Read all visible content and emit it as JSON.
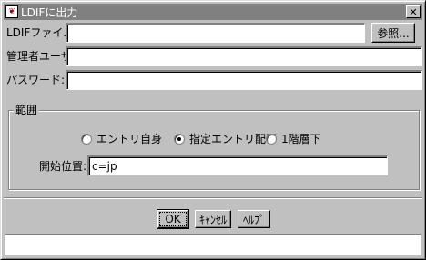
{
  "window": {
    "title": "LDIFに出力",
    "close_icon": "close-icon"
  },
  "form": {
    "ldif_file_label": "LDIFファイル名:",
    "ldif_file_value": "",
    "browse_label": "参照...",
    "admin_user_label": "管理者ユーザ:",
    "admin_user_value": "",
    "password_label": "パスワード:",
    "password_value": ""
  },
  "scope": {
    "group_label": "範囲",
    "options": [
      {
        "label": "エントリ自身",
        "selected": false
      },
      {
        "label": "指定エントリ配下",
        "selected": true
      },
      {
        "label": "1階層下",
        "selected": false
      }
    ],
    "start_label": "開始位置:",
    "start_value": "c=jp"
  },
  "buttons": {
    "ok": "OK",
    "cancel": "ｷｬﾝｾﾙ",
    "help": "ﾍﾙﾌﾟ"
  },
  "status": {
    "text": ""
  }
}
